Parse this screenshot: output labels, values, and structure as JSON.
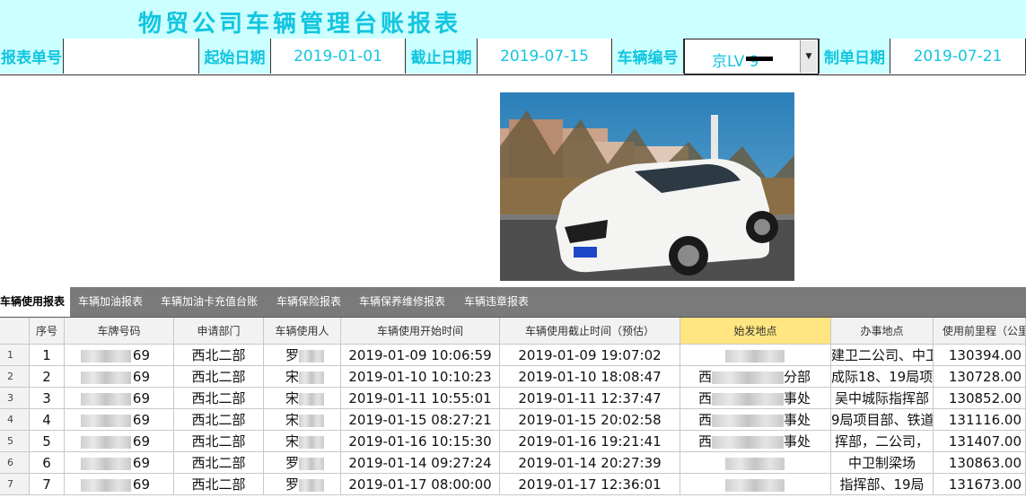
{
  "title": "物贸公司车辆管理台账报表",
  "form": {
    "report_no_label": "报表单号",
    "report_no_value": "",
    "start_label": "起始日期",
    "start_value": "2019-01-01",
    "end_label": "截止日期",
    "end_value": "2019-07-15",
    "vehicle_label": "车辆编号",
    "vehicle_value": "京LV        9",
    "made_label": "制单日期",
    "made_value": "2019-07-21"
  },
  "tabs": [
    "车辆使用报表",
    "车辆加油报表",
    "车辆加油卡充值台账",
    "车辆保险报表",
    "车辆保养维修报表",
    "车辆违章报表"
  ],
  "columns": [
    "序号",
    "车牌号码",
    "申请部门",
    "车辆使用人",
    "车辆使用开始时间",
    "车辆使用截止时间（预估）",
    "始发地点",
    "办事地点",
    "使用前里程（公里"
  ],
  "rows": [
    {
      "rownum": "1",
      "seq": "1",
      "plate": "69",
      "dept": "西北二部",
      "user": "罗",
      "start": "2019-01-09 10:06:59",
      "end": "2019-01-09 19:07:02",
      "origin": "",
      "dest": "建卫二公司、中卫",
      "mileage": "130394.00"
    },
    {
      "rownum": "2",
      "seq": "2",
      "plate": "69",
      "dept": "西北二部",
      "user": "宋",
      "start": "2019-01-10 10:10:23",
      "end": "2019-01-10 18:08:47",
      "origin": "西",
      "origin_suffix": "分部",
      "dest": "成际18、19局项",
      "mileage": "130728.00"
    },
    {
      "rownum": "3",
      "seq": "3",
      "plate": "69",
      "dept": "西北二部",
      "user": "宋",
      "start": "2019-01-11 10:55:01",
      "end": "2019-01-11 12:37:47",
      "origin": "西",
      "origin_suffix": "事处",
      "dest": "吴中城际指挥部",
      "mileage": "130852.00"
    },
    {
      "rownum": "4",
      "seq": "4",
      "plate": "69",
      "dept": "西北二部",
      "user": "宋",
      "start": "2019-01-15 08:27:21",
      "end": "2019-01-15 20:02:58",
      "origin": "西",
      "origin_suffix": "事处",
      "dest": "9局项目部、铁道",
      "mileage": "131116.00"
    },
    {
      "rownum": "5",
      "seq": "5",
      "plate": "69",
      "dept": "西北二部",
      "user": "宋",
      "start": "2019-01-16 10:15:30",
      "end": "2019-01-16 19:21:41",
      "origin": "西",
      "origin_suffix": "事处",
      "dest": "挥部，二公司，",
      "mileage": "131407.00"
    },
    {
      "rownum": "6",
      "seq": "6",
      "plate": "69",
      "dept": "西北二部",
      "user": "罗",
      "start": "2019-01-14 09:27:24",
      "end": "2019-01-14 20:27:39",
      "origin": "",
      "dest": "中卫制梁场",
      "mileage": "130863.00"
    },
    {
      "rownum": "7",
      "seq": "7",
      "plate": "69",
      "dept": "西北二部",
      "user": "罗",
      "start": "2019-01-17 08:00:00",
      "end": "2019-01-17 12:36:01",
      "origin": "",
      "dest": "指挥部、19局",
      "mileage": "131673.00"
    }
  ]
}
